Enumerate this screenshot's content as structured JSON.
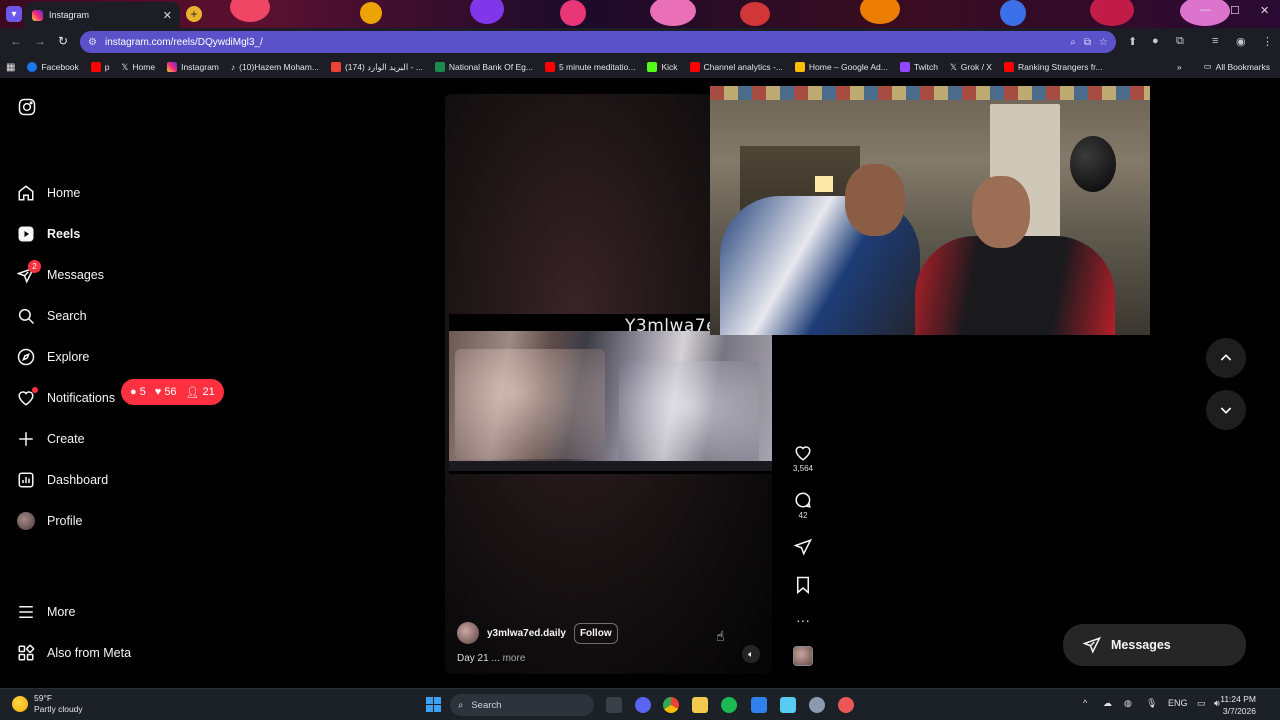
{
  "browser": {
    "tab_title": "Instagram",
    "url": "instagram.com/reels/DQywdiMgl3_/",
    "bookmarks": [
      {
        "label": "Facebook",
        "color": "#1877f2"
      },
      {
        "label": "p",
        "color": "#ff0000"
      },
      {
        "label": "Home",
        "color": "#e6e6e6"
      },
      {
        "label": "Instagram",
        "color": "#e1306c"
      },
      {
        "label": "(10)Hazem Moham...",
        "color": "#e6e6e6"
      },
      {
        "label": "(174) البريد الوارد - ...",
        "color": "#ea4335"
      },
      {
        "label": "National Bank Of Eg...",
        "color": "#1c8a4c"
      },
      {
        "label": "5 minute meditatio...",
        "color": "#ff0000"
      },
      {
        "label": "Kick",
        "color": "#53fc18"
      },
      {
        "label": "Channel analytics -...",
        "color": "#ff0000"
      },
      {
        "label": "Home – Google Ad...",
        "color": "#fbbc04"
      },
      {
        "label": "Twitch",
        "color": "#9146ff"
      },
      {
        "label": "Grok / X",
        "color": "#e6e6e6"
      },
      {
        "label": "Ranking Strangers fr...",
        "color": "#ff0000"
      }
    ],
    "all_bookmarks": "All Bookmarks"
  },
  "sidebar": {
    "items": [
      {
        "label": "Home",
        "icon": "home-icon"
      },
      {
        "label": "Reels",
        "icon": "reels-icon"
      },
      {
        "label": "Messages",
        "icon": "messages-icon",
        "badge": "2"
      },
      {
        "label": "Search",
        "icon": "search-icon"
      },
      {
        "label": "Explore",
        "icon": "explore-icon"
      },
      {
        "label": "Notifications",
        "icon": "heart-icon"
      },
      {
        "label": "Create",
        "icon": "plus-icon"
      },
      {
        "label": "Dashboard",
        "icon": "dashboard-icon"
      },
      {
        "label": "Profile",
        "icon": "avatar"
      },
      {
        "label": "More",
        "icon": "menu-icon"
      },
      {
        "label": "Also from Meta",
        "icon": "meta-icon"
      }
    ],
    "notifications_pill": {
      "comments": "5",
      "likes": "56",
      "follows": "21"
    }
  },
  "reel": {
    "caption_overlay": "Y3mlwa7ed",
    "username": "y3mlwa7ed.daily",
    "follow_label": "Follow",
    "description": "Day 21 ...",
    "more_label": "more",
    "likes": "3,564",
    "comments": "42"
  },
  "floating_messages": {
    "label": "Messages"
  },
  "taskbar": {
    "temperature": "59°F",
    "weather": "Partly cloudy",
    "search_placeholder": "Search",
    "language": "ENG",
    "time": "11:24 PM",
    "date": "3/7/2026"
  }
}
